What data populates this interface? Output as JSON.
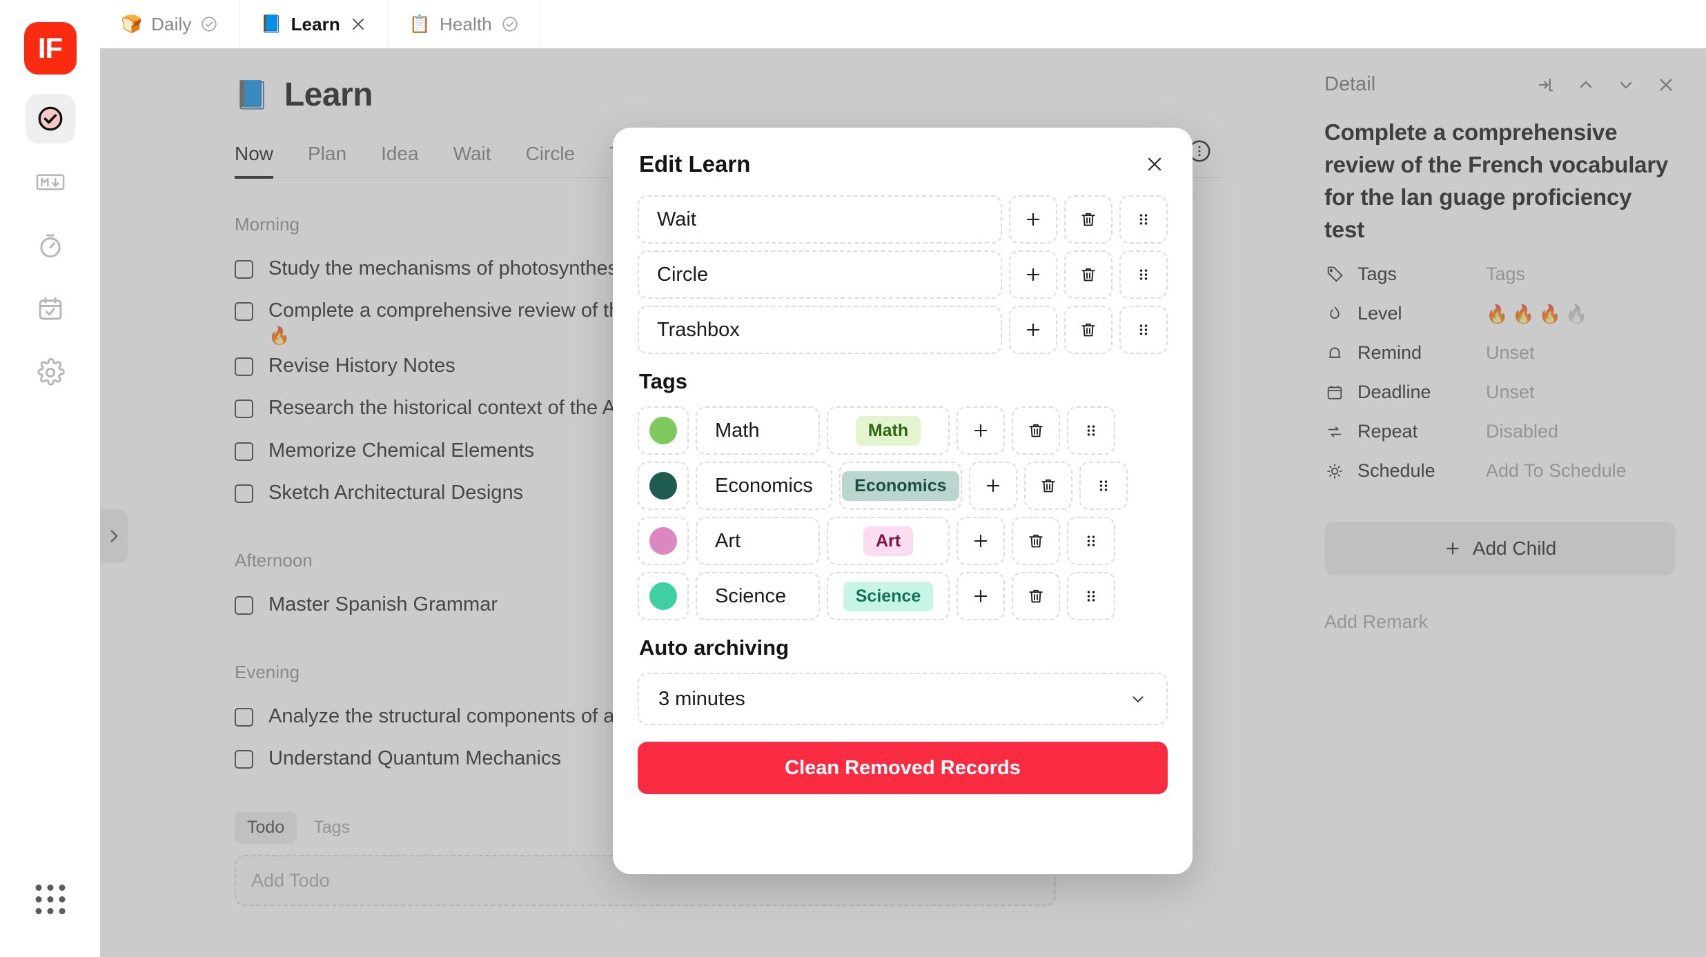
{
  "app": {
    "logo_text": "IF"
  },
  "tabs": [
    {
      "emoji": "🍞",
      "label": "Daily",
      "action_icon": "check-circle-icon",
      "active": false
    },
    {
      "emoji": "📘",
      "label": "Learn",
      "action_icon": "close-icon",
      "active": true
    },
    {
      "emoji": "📋",
      "label": "Health",
      "action_icon": "check-circle-icon",
      "active": false
    }
  ],
  "rail": {
    "items": [
      {
        "name": "tasks",
        "icon": "check-circle-icon",
        "active": true
      },
      {
        "name": "markdown",
        "icon": "markdown-icon",
        "active": false
      },
      {
        "name": "timer",
        "icon": "timer-icon",
        "active": false
      },
      {
        "name": "calendar",
        "icon": "calendar-check-icon",
        "active": false
      },
      {
        "name": "settings",
        "icon": "gear-icon",
        "active": false
      }
    ],
    "apps_icon": "grid-dots-icon"
  },
  "page": {
    "emoji": "📘",
    "title": "Learn",
    "subtabs": [
      {
        "label": "Now",
        "active": true
      },
      {
        "label": "Plan",
        "active": false
      },
      {
        "label": "Idea",
        "active": false
      },
      {
        "label": "Wait",
        "active": false
      },
      {
        "label": "Circle",
        "active": false
      },
      {
        "label": "Trashbox",
        "active": false
      }
    ],
    "toolbar": [
      {
        "name": "focus-lotus-icon"
      },
      {
        "name": "filter-sliders-icon"
      },
      {
        "name": "more-options-icon"
      }
    ],
    "sections": [
      {
        "label": "Morning",
        "todos": [
          {
            "text": "Study the mechanisms of photosynthesis",
            "flame": ""
          },
          {
            "text": "Complete a comprehensive review of the French vocabulary",
            "flame": "🔥"
          },
          {
            "text": "Revise History Notes",
            "flame": ""
          },
          {
            "text": "Research the historical context of the Ancient Rome",
            "flame": ""
          },
          {
            "text": "Memorize Chemical Elements",
            "flame": ""
          },
          {
            "text": "Sketch Architectural Designs",
            "flame": ""
          }
        ]
      },
      {
        "label": "Afternoon",
        "todos": [
          {
            "text": "Master Spanish Grammar",
            "flame": ""
          }
        ]
      },
      {
        "label": "Evening",
        "todos": [
          {
            "text": "Analyze the structural components of a sentence",
            "flame": ""
          },
          {
            "text": "Understand Quantum Mechanics",
            "flame": ""
          }
        ]
      }
    ],
    "footer_chips": [
      "Todo",
      "Tags"
    ],
    "add_todo_placeholder": "Add Todo",
    "collapse_icon": "chevron-right-icon"
  },
  "detail": {
    "header": "Detail",
    "header_actions": [
      {
        "name": "open-in-icon"
      },
      {
        "name": "chevron-up-icon"
      },
      {
        "name": "chevron-down-icon"
      },
      {
        "name": "close-icon"
      }
    ],
    "title": "Complete a comprehensive review of the French vocabulary for the lan guage proficiency test",
    "props": [
      {
        "icon": "tag-icon",
        "label": "Tags",
        "value": "Tags"
      },
      {
        "icon": "flame-icon",
        "label": "Level",
        "value": "",
        "level": 3,
        "level_max": 4
      },
      {
        "icon": "bell-icon",
        "label": "Remind",
        "value": "Unset"
      },
      {
        "icon": "calendar-icon",
        "label": "Deadline",
        "value": "Unset"
      },
      {
        "icon": "repeat-icon",
        "label": "Repeat",
        "value": "Disabled"
      },
      {
        "icon": "sun-icon",
        "label": "Schedule",
        "value": "Add To Schedule"
      }
    ],
    "add_child_label": "Add Child",
    "add_child_icon": "plus-icon",
    "add_remark_label": "Add Remark"
  },
  "modal": {
    "title": "Edit Learn",
    "close_icon": "close-icon",
    "lists": [
      {
        "name": "Wait"
      },
      {
        "name": "Circle"
      },
      {
        "name": "Trashbox"
      }
    ],
    "tags_section_title": "Tags",
    "tags": [
      {
        "name": "Math",
        "dot": "#7DC95E",
        "chip_bg": "#E3F5CE",
        "chip_fg": "#2E6612"
      },
      {
        "name": "Economics",
        "dot": "#1F5C50",
        "chip_bg": "#BBD6CF",
        "chip_fg": "#1B4E44"
      },
      {
        "name": "Art",
        "dot": "#DB87C0",
        "chip_bg": "#FBDCF0",
        "chip_fg": "#7A1148"
      },
      {
        "name": "Science",
        "dot": "#3ECFA5",
        "chip_bg": "#C7F5E6",
        "chip_fg": "#13725A"
      }
    ],
    "row_actions": [
      {
        "name": "add-icon"
      },
      {
        "name": "delete-icon"
      },
      {
        "name": "drag-handle-icon"
      }
    ],
    "auto_archiving_title": "Auto archiving",
    "auto_archiving_value": "3 minutes",
    "auto_archiving_chevron": "chevron-down-icon",
    "clean_button_label": "Clean Removed Records",
    "clean_button_color": "#FB2C42"
  }
}
